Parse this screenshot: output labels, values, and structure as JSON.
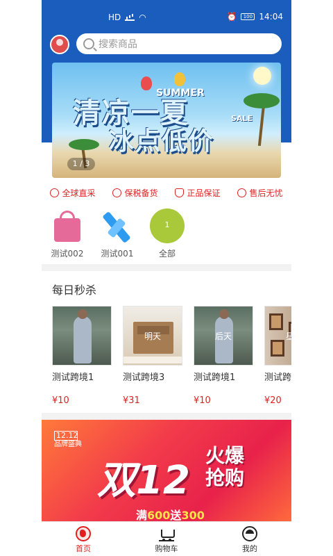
{
  "status_bar": {
    "network": "HD",
    "battery": "100",
    "time": "14:04"
  },
  "search": {
    "placeholder": "搜索商品"
  },
  "banner": {
    "title_line1": "清凉一夏",
    "title_line2": "冰点低价",
    "summer_text": "SUMMER",
    "sale_text": "SALE",
    "pager": "1 / 3"
  },
  "features": [
    {
      "label": "全球直采",
      "icon": "globe-icon"
    },
    {
      "label": "保税备货",
      "icon": "tax-icon"
    },
    {
      "label": "正品保证",
      "icon": "shield-icon"
    },
    {
      "label": "售后无忧",
      "icon": "service-icon"
    }
  ],
  "categories": [
    {
      "label": "测试002",
      "icon": "bag-icon"
    },
    {
      "label": "测试001",
      "icon": "x-logo-icon"
    },
    {
      "label": "全部",
      "badge": "1",
      "icon": "ball-icon"
    }
  ],
  "flash_sale": {
    "title": "每日秒杀",
    "items": [
      {
        "name": "测试跨境1",
        "price": "¥10",
        "overlay": ""
      },
      {
        "name": "测试跨境3",
        "price": "¥31",
        "overlay": "明天"
      },
      {
        "name": "测试跨境1",
        "price": "¥10",
        "overlay": "后天"
      },
      {
        "name": "测试跨",
        "price": "¥20",
        "overlay": "星期"
      }
    ]
  },
  "promo": {
    "logo_top": "12.12",
    "logo_bottom": "品牌盛典",
    "big_text": "双12",
    "hot_line1": "火爆",
    "hot_line2": "抢购",
    "sub_prefix": "满",
    "sub_amount1": "600",
    "sub_mid": "送",
    "sub_amount2": "300"
  },
  "tabbar": {
    "tabs": [
      {
        "label": "首页",
        "active": true
      },
      {
        "label": "购物车",
        "active": false
      },
      {
        "label": "我的",
        "active": false
      }
    ]
  },
  "colors": {
    "header_blue": "#1a5dbd",
    "accent_red": "#e02020"
  }
}
